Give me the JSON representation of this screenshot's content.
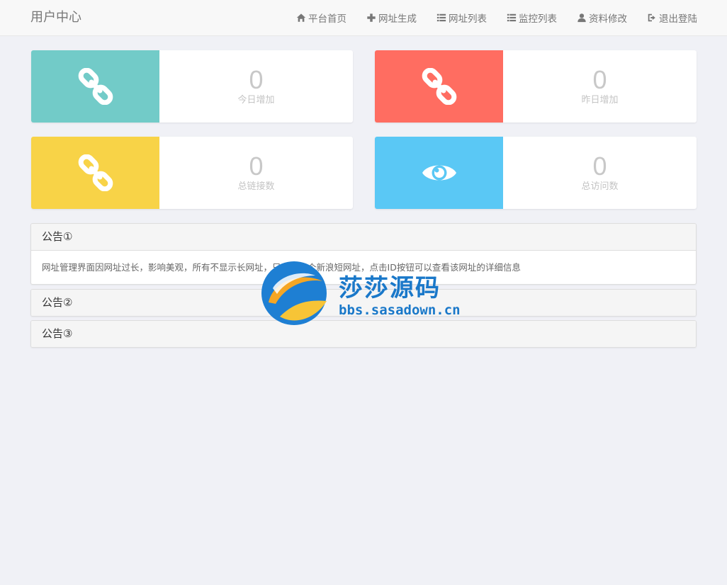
{
  "navbar": {
    "brand": "用户中心",
    "items": [
      {
        "label": "平台首页",
        "icon": "home-icon"
      },
      {
        "label": "网址生成",
        "icon": "plus-icon"
      },
      {
        "label": "网址列表",
        "icon": "list-icon"
      },
      {
        "label": "监控列表",
        "icon": "list-icon"
      },
      {
        "label": "资料修改",
        "icon": "user-icon"
      },
      {
        "label": "退出登陆",
        "icon": "logout-icon"
      }
    ]
  },
  "stats": [
    {
      "value": "0",
      "label": "今日增加",
      "icon": "link-icon",
      "color": "#72cbc8"
    },
    {
      "value": "0",
      "label": "昨日增加",
      "icon": "link-icon",
      "color": "#ff6d61"
    },
    {
      "value": "0",
      "label": "总链接数",
      "icon": "link-icon",
      "color": "#f8d347"
    },
    {
      "value": "0",
      "label": "总访问数",
      "icon": "eye-icon",
      "color": "#5ac8f5"
    }
  ],
  "notices": [
    {
      "title": "公告①",
      "body": "网址管理界面因网址过长，影响美观，所有不显示长网址，只显示一个新浪短网址，点击ID按钮可以查看该网址的详细信息"
    },
    {
      "title": "公告②"
    },
    {
      "title": "公告③"
    }
  ],
  "watermark": {
    "text": "莎莎源码",
    "url": "bbs.sasadown.cn"
  }
}
